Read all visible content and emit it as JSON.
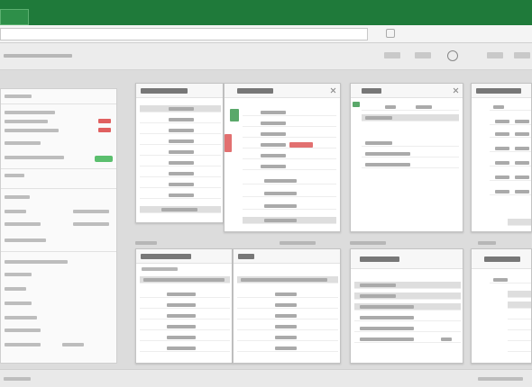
{
  "title_bar": {
    "title": ""
  },
  "toolbar": {
    "address_value": ""
  },
  "header": {
    "app_title": ""
  },
  "sidebar": {
    "items": []
  },
  "windows": [
    {
      "title": ""
    },
    {
      "title": ""
    },
    {
      "title": ""
    },
    {
      "title": ""
    },
    {
      "title": ""
    },
    {
      "title": ""
    },
    {
      "title": ""
    },
    {
      "title": ""
    }
  ],
  "footer": {
    "status": ""
  },
  "colors": {
    "title_bar": "#1f7a3a",
    "accent_green": "#5bbf6e",
    "accent_red": "#e06060",
    "background": "#dcdcdc"
  },
  "icons": [
    "search-icon",
    "close-icon",
    "window-control-icon"
  ]
}
